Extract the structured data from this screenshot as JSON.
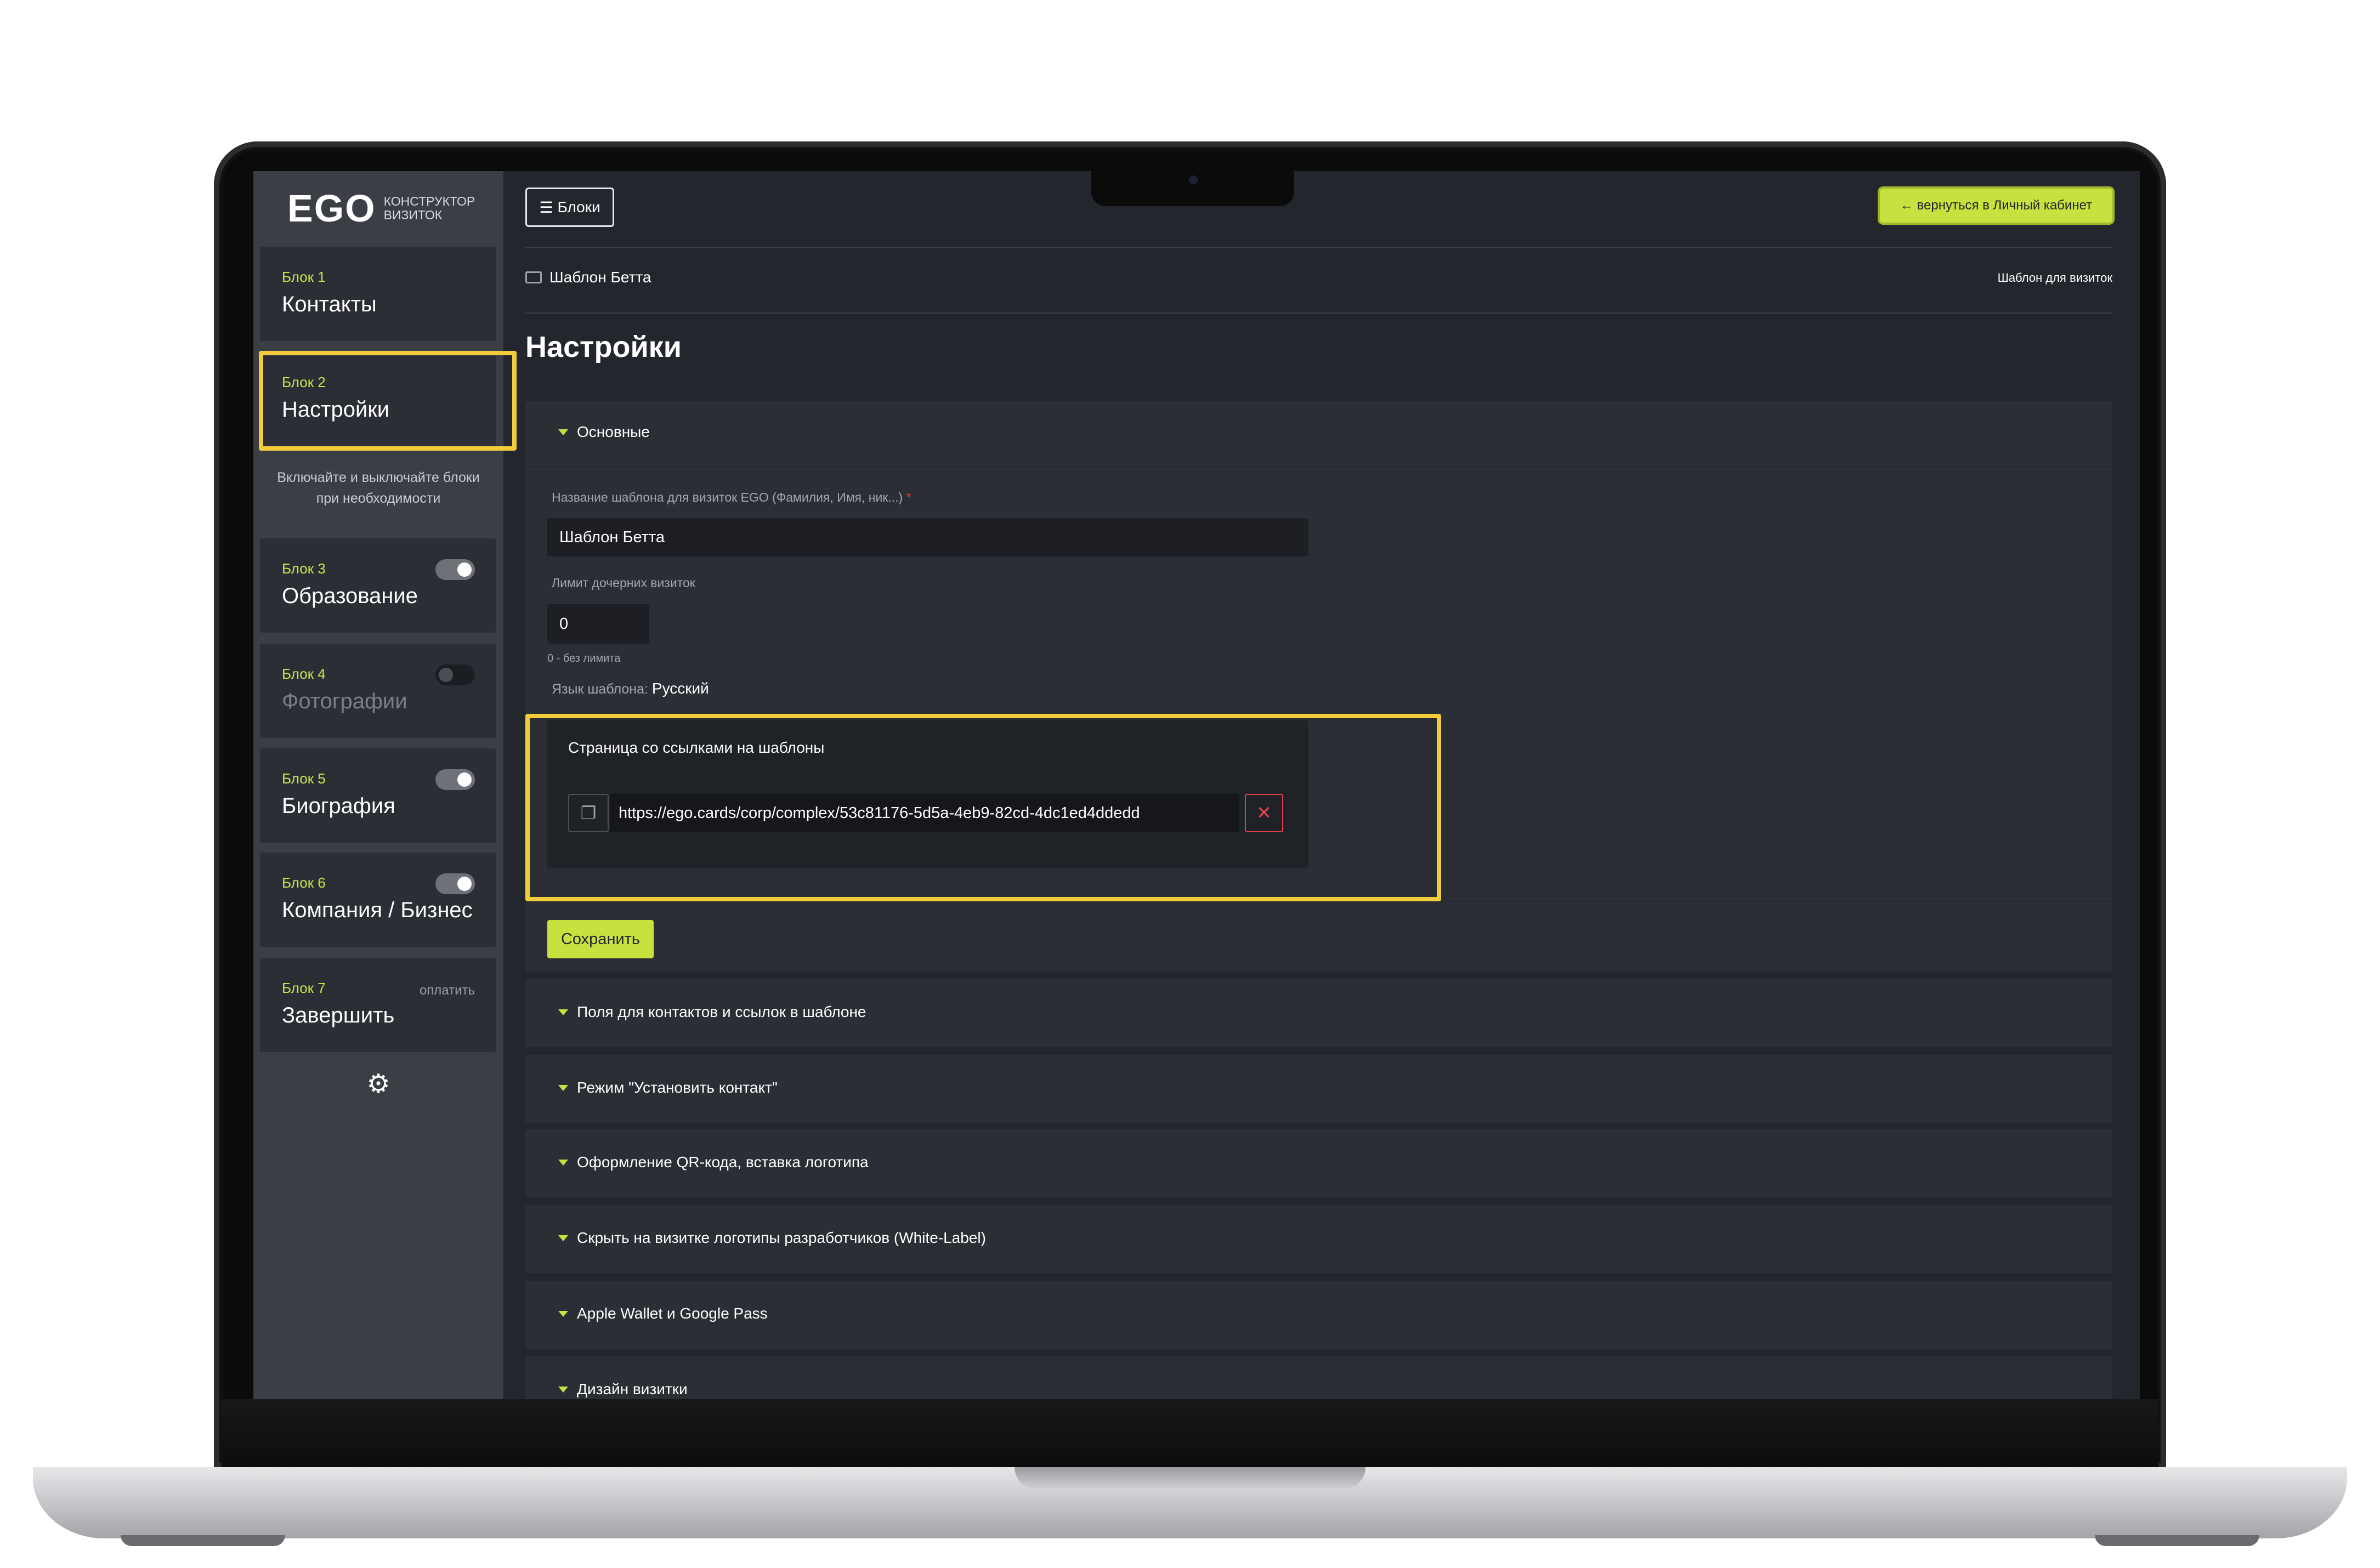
{
  "sidebar": {
    "logo": "EGO",
    "logo_sub": [
      "конструктор",
      "визиток"
    ],
    "note": "Включайте и выключайте блоки при необходимости",
    "blocks": [
      {
        "label": "Блок 1",
        "name": "Контакты"
      },
      {
        "label": "Блок 2",
        "name": "Настройки"
      },
      {
        "label": "Блок 3",
        "name": "Образование",
        "toggle": "on"
      },
      {
        "label": "Блок 4",
        "name": "Фотографии",
        "toggle": "off"
      },
      {
        "label": "Блок 5",
        "name": "Биография",
        "toggle": "on"
      },
      {
        "label": "Блок 6",
        "name": "Компания / Бизнес",
        "toggle": "on"
      },
      {
        "label": "Блок 7",
        "name": "Завершить",
        "extra": "оплатить"
      }
    ],
    "settings_icon": "gear-icon"
  },
  "header": {
    "blocks_button": "Блоки",
    "menu_icon": "menu-icon",
    "back_button": "← вернуться в Личный кабинет"
  },
  "breadcrumb": {
    "icon": "id-card-icon",
    "text": "Шаблон Бетта",
    "right": "Шаблон для визиток"
  },
  "page": {
    "title": "Настройки"
  },
  "main_section": {
    "title": "Основные",
    "name_label": "Название шаблона для визиток EGO (Фамилия, Имя, ник...)",
    "required_mark": "*",
    "name_value": "Шаблон Бетта",
    "limit_label": "Лимит дочерних визиток",
    "limit_value": "0",
    "limit_hint": "0 - без лимита",
    "lang_label": "Язык шаблона:",
    "lang_value": "Русский",
    "links_title": "Страница со ссылками на шаблоны",
    "link_url": "https://ego.cards/corp/complex/53c81176-5d5a-4eb9-82cd-4dc1ed4ddedd",
    "copy_icon": "copy-icon",
    "delete_icon": "close-icon",
    "save_button": "Сохранить"
  },
  "accordions": [
    "Поля для контактов и ссылок в шаблоне",
    "Режим \"Установить контакт\"",
    "Оформление QR-кода, вставка логотипа",
    "Скрыть на визитке логотипы разработчиков (White-Label)",
    "Apple Wallet и Google Pass",
    "Дизайн визитки"
  ],
  "colors": {
    "accent": "#c7e23f",
    "highlight": "#f3cc3c",
    "danger": "#e0414c",
    "background": "#23262c",
    "sidebar": "#3b3e45"
  }
}
